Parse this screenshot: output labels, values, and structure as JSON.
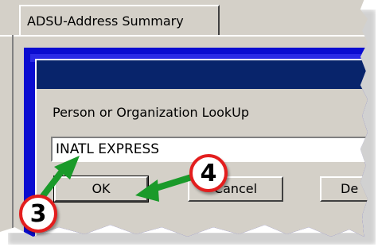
{
  "window": {
    "tab_label": "ADSU-Address Summary"
  },
  "dialog": {
    "group_label": "Person or Organization LookUp",
    "lookup_value": "INATL EXPRESS",
    "buttons": {
      "ok": "OK",
      "cancel": "Cancel",
      "delete": "De"
    },
    "titlebar_color": "#08246b"
  },
  "annotations": {
    "step3": "3",
    "step4": "4",
    "arrow_color": "#1a9a2a",
    "callout_border_color": "#e31e1e"
  }
}
